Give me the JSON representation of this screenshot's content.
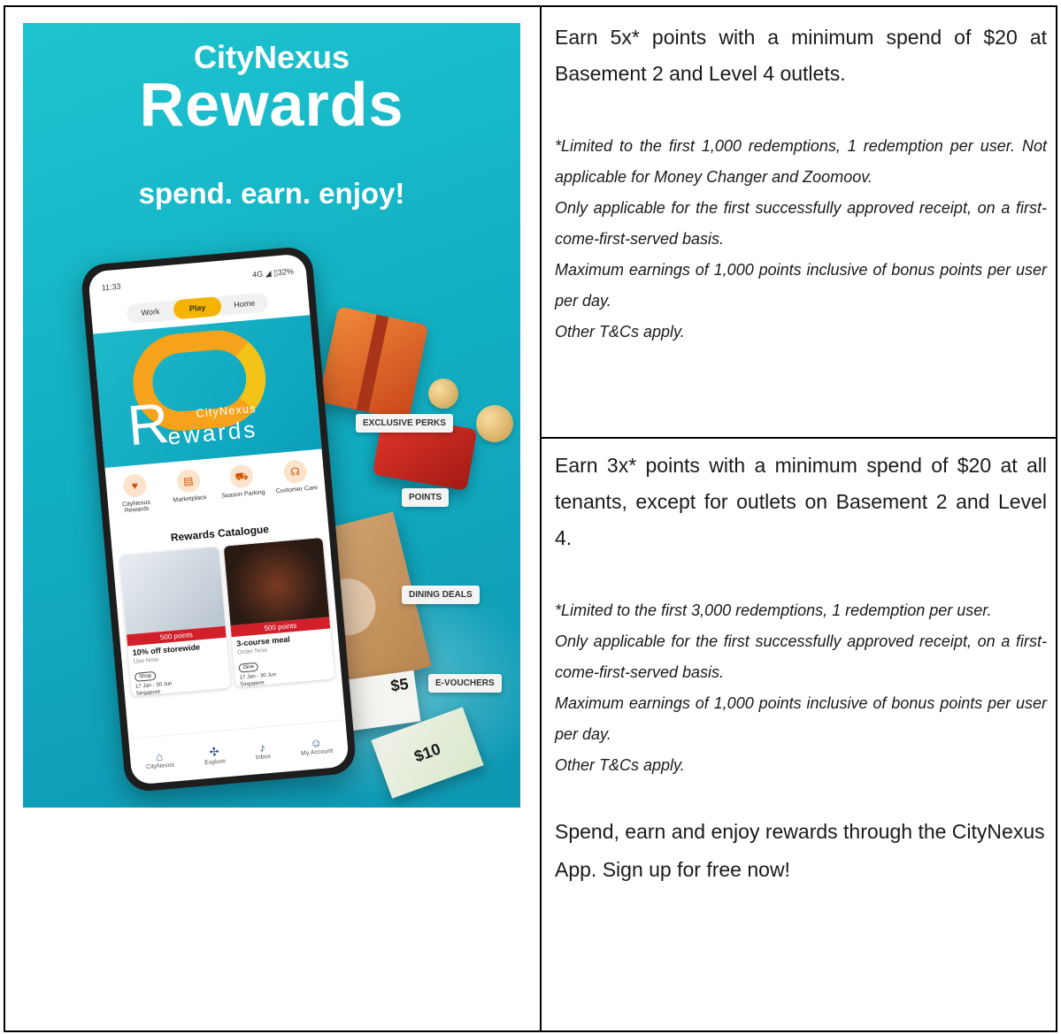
{
  "poster": {
    "brand_line1": "CityNexus",
    "brand_line2": "Rewards",
    "tagline": "spend. earn. enjoy!",
    "colors": {
      "background": "#12b0c4",
      "accent_orange": "#f6a21a",
      "accent_red": "#d1202a"
    },
    "phone": {
      "status_time": "11:33",
      "status_right": "4G ◢ ▯32%",
      "tabs": [
        "Work",
        "Play",
        "Home"
      ],
      "active_tab": "Play",
      "logo_city": "CityNexus",
      "logo_r": "R",
      "logo_rest": "ewards",
      "shortcuts": [
        {
          "label": "CityNexus Rewards",
          "icon": "rewards-icon"
        },
        {
          "label": "Marketplace",
          "icon": "store-icon"
        },
        {
          "label": "Season Parking",
          "icon": "car-icon"
        },
        {
          "label": "Customer Care",
          "icon": "headset-icon"
        }
      ],
      "catalogue_title": "Rewards Catalogue",
      "cards": [
        {
          "points": "500 points",
          "title": "10% off storewide",
          "action": "Use Now",
          "chip": "Shop",
          "date": "17 Jan - 30 Jun",
          "location": "Singapore"
        },
        {
          "points": "500 points",
          "title": "3-course meal",
          "action": "Order Now",
          "chip": "Dine",
          "date": "17 Jan - 30 Jun",
          "location": "Singapore"
        }
      ],
      "nav": [
        {
          "label": "CityNexus",
          "icon": "home-icon"
        },
        {
          "label": "Explore",
          "icon": "pinwheel-icon"
        },
        {
          "label": "Inbox",
          "icon": "bell-icon"
        },
        {
          "label": "My Account",
          "icon": "user-icon"
        }
      ]
    },
    "tags": [
      "EXCLUSIVE PERKS",
      "POINTS",
      "DINING DEALS",
      "E-VOUCHERS"
    ],
    "voucher_values": [
      "$5",
      "$10"
    ]
  },
  "offer1": {
    "headline": "Earn 5x* points with a minimum spend of $20 at Basement 2 and Level 4 outlets.",
    "notes": [
      "*Limited to the first 1,000 redemptions, 1 redemption per user. Not applicable for Money Changer and Zoomoov.",
      "Only applicable for the first successfully approved receipt, on a first-come-first-served basis.",
      "Maximum earnings of 1,000 points inclusive of bonus points per user per day.",
      "Other T&Cs apply."
    ]
  },
  "offer2": {
    "headline": "Earn 3x* points with a minimum spend of $20 at all tenants, except for outlets on Basement 2 and Level 4.",
    "notes": [
      "*Limited to the first 3,000 redemptions, 1 redemption per user.",
      "Only applicable for the first successfully approved receipt, on a first-come-first-served basis.",
      "Maximum earnings of 1,000 points inclusive of bonus points per user per day.",
      "Other T&Cs apply."
    ],
    "cta": "Spend, earn and enjoy rewards through the CityNexus App. Sign up for free now!"
  }
}
